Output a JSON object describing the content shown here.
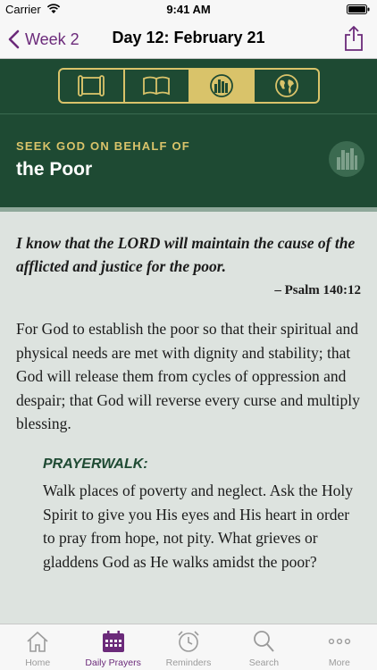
{
  "status_bar": {
    "carrier": "Carrier",
    "time": "9:41 AM"
  },
  "nav": {
    "back_label": "Week 2",
    "title": "Day 12: February 21",
    "accent_color": "#6b2a7a"
  },
  "segments": [
    {
      "icon": "scroll-icon",
      "active": false
    },
    {
      "icon": "open-book-icon",
      "active": false
    },
    {
      "icon": "city-icon",
      "active": true
    },
    {
      "icon": "globe-icon",
      "active": false
    }
  ],
  "header": {
    "eyebrow": "SEEK GOD ON BEHALF OF",
    "title": "the Poor",
    "badge_icon": "city-icon",
    "background": "#1e4a33",
    "gold": "#d9c36a"
  },
  "content": {
    "verse": "I know that the LORD will maintain the cause of the afflicted and justice for the poor.",
    "verse_ref": "– Psalm 140:12",
    "body": "For God to establish the poor so that their spiritual and physical needs are met with dignity and stability; that God will release them from cycles of oppression and despair; that God will reverse every curse and multiply blessing.",
    "prayerwalk_label": "PRAYERWALK:",
    "prayerwalk_text": "Walk places of poverty and neglect. Ask the Holy Spirit to give you His eyes and His heart in order to pray from hope, not pity. What grieves or gladdens God as He walks amidst the poor?"
  },
  "tabs": [
    {
      "label": "Home",
      "icon": "home-icon",
      "active": false
    },
    {
      "label": "Daily Prayers",
      "icon": "calendar-icon",
      "active": true
    },
    {
      "label": "Reminders",
      "icon": "alarm-clock-icon",
      "active": false
    },
    {
      "label": "Search",
      "icon": "search-icon",
      "active": false
    },
    {
      "label": "More",
      "icon": "more-icon",
      "active": false
    }
  ]
}
